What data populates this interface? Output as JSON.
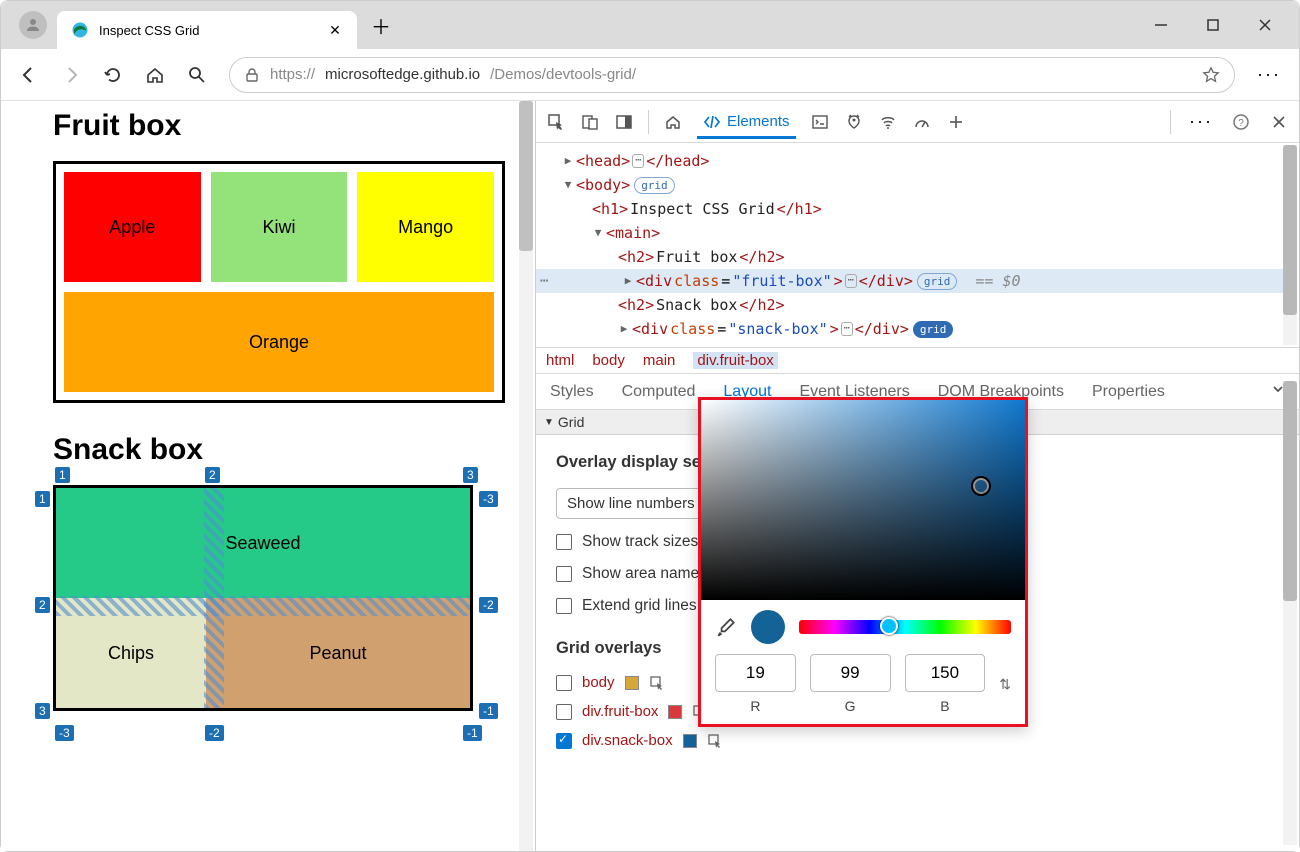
{
  "browser": {
    "tab_title": "Inspect CSS Grid",
    "url_proto": "https://",
    "url_host": "microsoftedge.github.io",
    "url_path": "/Demos/devtools-grid/"
  },
  "page": {
    "h1": "Fruit box",
    "fruit": {
      "apple": "Apple",
      "kiwi": "Kiwi",
      "mango": "Mango",
      "orange": "Orange"
    },
    "h2": "Snack box",
    "snack": {
      "seaweed": "Seaweed",
      "chips": "Chips",
      "peanut": "Peanut"
    },
    "grid_nums": {
      "top": [
        "1",
        "2",
        "3"
      ],
      "left": [
        "1",
        "2",
        "3"
      ],
      "right_neg": [
        "-3",
        "-2",
        "-1"
      ],
      "bottom_neg": [
        "-1",
        "-2",
        "-3"
      ]
    }
  },
  "devtools": {
    "elements_label": "Elements",
    "dom": {
      "head": "head",
      "body": "body",
      "grid_pill": "grid",
      "h1_text": "Inspect CSS Grid",
      "main": "main",
      "h2_fruit": "Fruit box",
      "div_fruit_cls": "fruit-box",
      "h2_snack": "Snack box",
      "div_snack_cls": "snack-box",
      "sel_dollar": "== $0"
    },
    "breadcrumb": [
      "html",
      "body",
      "main",
      "div.fruit-box"
    ],
    "style_tabs": [
      "Styles",
      "Computed",
      "Layout",
      "Event Listeners",
      "DOM Breakpoints",
      "Properties"
    ],
    "grid_section": "Grid",
    "layout": {
      "overlay_heading": "Overlay display settings",
      "show_line_numbers": "Show line numbers",
      "show_track_sizes": "Show track sizes",
      "show_area_names": "Show area names",
      "extend_grid_lines": "Extend grid lines",
      "grid_overlays_heading": "Grid overlays",
      "overlays": [
        {
          "label": "body",
          "color": "#d5a63a",
          "checked": false
        },
        {
          "label": "div.fruit-box",
          "color": "#d63a3a",
          "checked": false
        },
        {
          "label": "div.snack-box",
          "color": "#13639a",
          "checked": true
        }
      ]
    },
    "picker": {
      "swatch": "#136396",
      "r": "19",
      "g": "99",
      "b": "150",
      "r_label": "R",
      "g_label": "G",
      "b_label": "B"
    }
  }
}
